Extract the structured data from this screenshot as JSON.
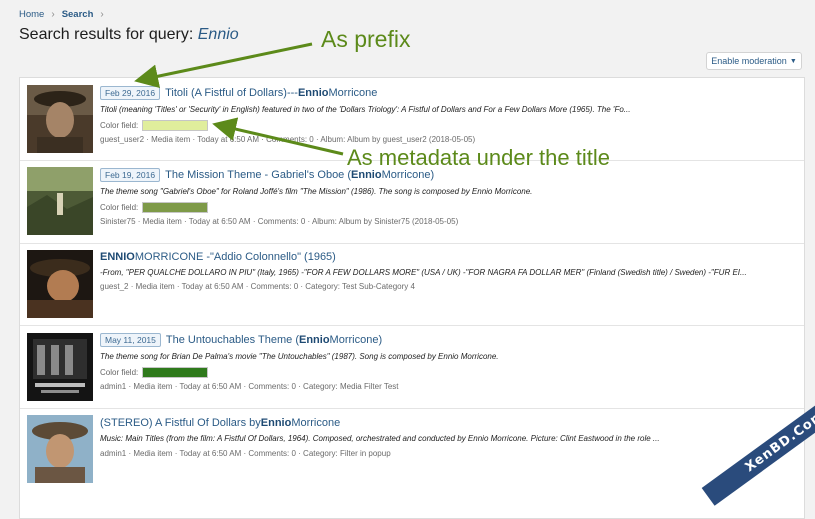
{
  "breadcrumb": {
    "home": "Home",
    "search": "Search"
  },
  "page": {
    "title_prefix": "Search results for query:",
    "query": "Ennio"
  },
  "moderation_button": "Enable moderation",
  "annotations": {
    "prefix": "As prefix",
    "metadata": "As metadata under the title"
  },
  "results": [
    {
      "date": "Feb 29, 2016",
      "title_pre": "Titoli (A Fistful of Dollars)---",
      "title_hl": "Ennio",
      "title_post": " Morricone",
      "snippet": "Titoli (meaning 'Titles' or 'Security' in English) featured in two of the 'Dollars Triology': A Fistful of Dollars and For a Few Dollars More (1965). The 'Fo...",
      "color_label": "Color field:",
      "color": "#e0ee9c",
      "meta": "guest_user2 · Media item · Today at 6:50 AM · Comments: 0 · Album: Album by guest_user2 (2018-05-05)"
    },
    {
      "date": "Feb 19, 2016",
      "title_pre": "The Mission Theme - Gabriel's Oboe (",
      "title_hl": "Ennio",
      "title_post": " Morricone)",
      "snippet": "The theme song \"Gabriel's Oboe\" for Roland Joffé's film \"The Mission\" (1986). The song is composed by Ennio Morricone.",
      "color_label": "Color field:",
      "color": "#7e9a48",
      "meta": "Sinister75 · Media item · Today at 6:50 AM · Comments: 0 · Album: Album by Sinister75 (2018-05-05)"
    },
    {
      "date": "",
      "title_pre": "",
      "title_hl": "ENNIO",
      "title_post": " MORRICONE -\"Addio Colonnello\" (1965)",
      "snippet": "-From, \"PER QUALCHE DOLLARO IN PIU\" (Italy, 1965) -\"FOR A FEW DOLLARS MORE\" (USA / UK) -\"FOR NAGRA FA DOLLAR MER\" (Finland (Swedish title) / Sweden) -\"FUR EI...",
      "color_label": "",
      "color": "",
      "meta": "guest_2 · Media item · Today at 6:50 AM · Comments: 0 · Category: Test Sub-Category 4"
    },
    {
      "date": "May 11, 2015",
      "title_pre": "The Untouchables Theme (",
      "title_hl": "Ennio",
      "title_post": " Morricone)",
      "snippet": "The theme song for Brian De Palma's movie \"The Untouchables\" (1987). Song is composed by Ennio Morricone.",
      "color_label": "Color field:",
      "color": "#2f7a1c",
      "meta": "admin1 · Media item · Today at 6:50 AM · Comments: 0 · Category: Media Filter Test"
    },
    {
      "date": "",
      "title_pre": "(STEREO) A Fistful Of Dollars by ",
      "title_hl": "Ennio",
      "title_post": " Morricone",
      "snippet": "Music: Main Titles (from the film: A Fistful Of Dollars, 1964). Composed, orchestrated and conducted by Ennio Morricone. Picture: Clint Eastwood in the role ...",
      "color_label": "",
      "color": "",
      "meta": "admin1 · Media item · Today at 6:50 AM · Comments: 0 · Category: Filter in popup"
    }
  ],
  "watermark": "XenBD.Com"
}
